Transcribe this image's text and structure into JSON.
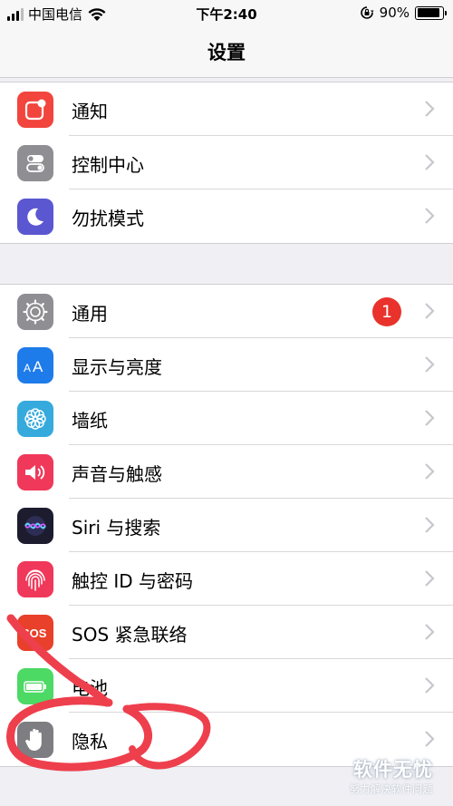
{
  "status_bar": {
    "carrier": "中国电信",
    "time": "下午2:40",
    "battery_percent": "90%",
    "battery_level": 0.9,
    "signal_bars_filled": 3,
    "signal_bars_total": 4
  },
  "nav": {
    "title": "设置"
  },
  "groups": [
    {
      "items": [
        {
          "label": "通知",
          "icon": "notifications-icon",
          "color": "#f2453d"
        },
        {
          "label": "控制中心",
          "icon": "control-center-icon",
          "color": "#8e8e93"
        },
        {
          "label": "勿扰模式",
          "icon": "moon-icon",
          "color": "#5b57d1"
        }
      ]
    },
    {
      "items": [
        {
          "label": "通用",
          "icon": "gear-icon",
          "color": "#8e8e93",
          "badge": "1"
        },
        {
          "label": "显示与亮度",
          "icon": "display-brightness-icon",
          "color": "#1e7bea"
        },
        {
          "label": "墙纸",
          "icon": "wallpaper-flower-icon",
          "color": "#36aadc"
        },
        {
          "label": "声音与触感",
          "icon": "speaker-icon",
          "color": "#f0385a"
        },
        {
          "label": "Siri 与搜索",
          "icon": "siri-icon",
          "color": "#1c1c2e"
        },
        {
          "label": "触控 ID 与密码",
          "icon": "fingerprint-icon",
          "color": "#f0385a"
        },
        {
          "label": "SOS 紧急联络",
          "icon": "sos-icon",
          "color": "#e8402b"
        },
        {
          "label": "电池",
          "icon": "battery-icon",
          "color": "#4cd964"
        },
        {
          "label": "隐私",
          "icon": "hand-icon",
          "color": "#7d7d82"
        }
      ]
    }
  ],
  "annotation": {
    "type": "hand-drawn circle and arrow",
    "color": "#ee3f4d",
    "target": "隐私"
  },
  "watermark": {
    "logo": "软件无忧",
    "tagline": "努力解决软件问题"
  },
  "colors": {
    "badge": "#e8322b",
    "chevron": "#c7c7cc",
    "background": "#efeff4"
  }
}
